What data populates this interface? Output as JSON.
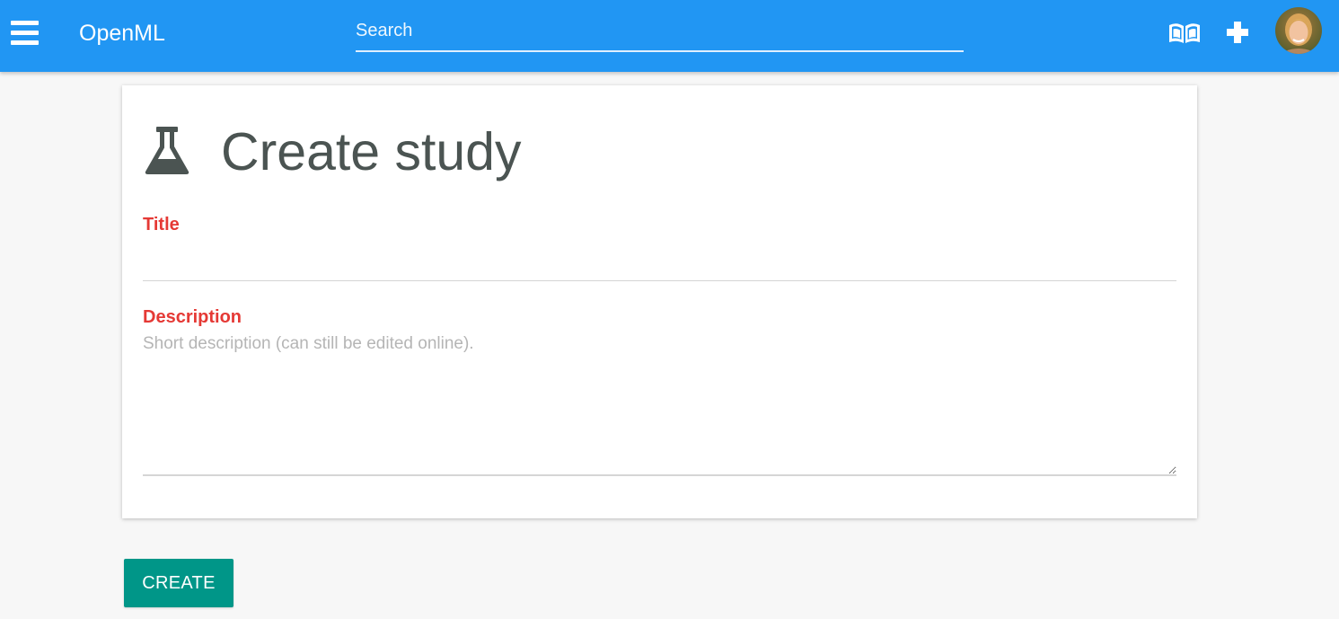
{
  "header": {
    "brand": "OpenML",
    "search": {
      "placeholder": "Search",
      "value": ""
    },
    "icons": [
      "menu-icon",
      "book-icon",
      "plus-icon",
      "avatar"
    ]
  },
  "form": {
    "title": "Create study",
    "title_field": {
      "label": "Title",
      "value": ""
    },
    "description_field": {
      "label": "Description",
      "placeholder": "Short description (can still be edited online).",
      "value": ""
    },
    "submit_label": "CREATE"
  },
  "colors": {
    "topbar": "#2196f3",
    "label": "#e53935",
    "button": "#009688",
    "title_text": "#4b5452",
    "page_background": "#f7f7f7"
  }
}
